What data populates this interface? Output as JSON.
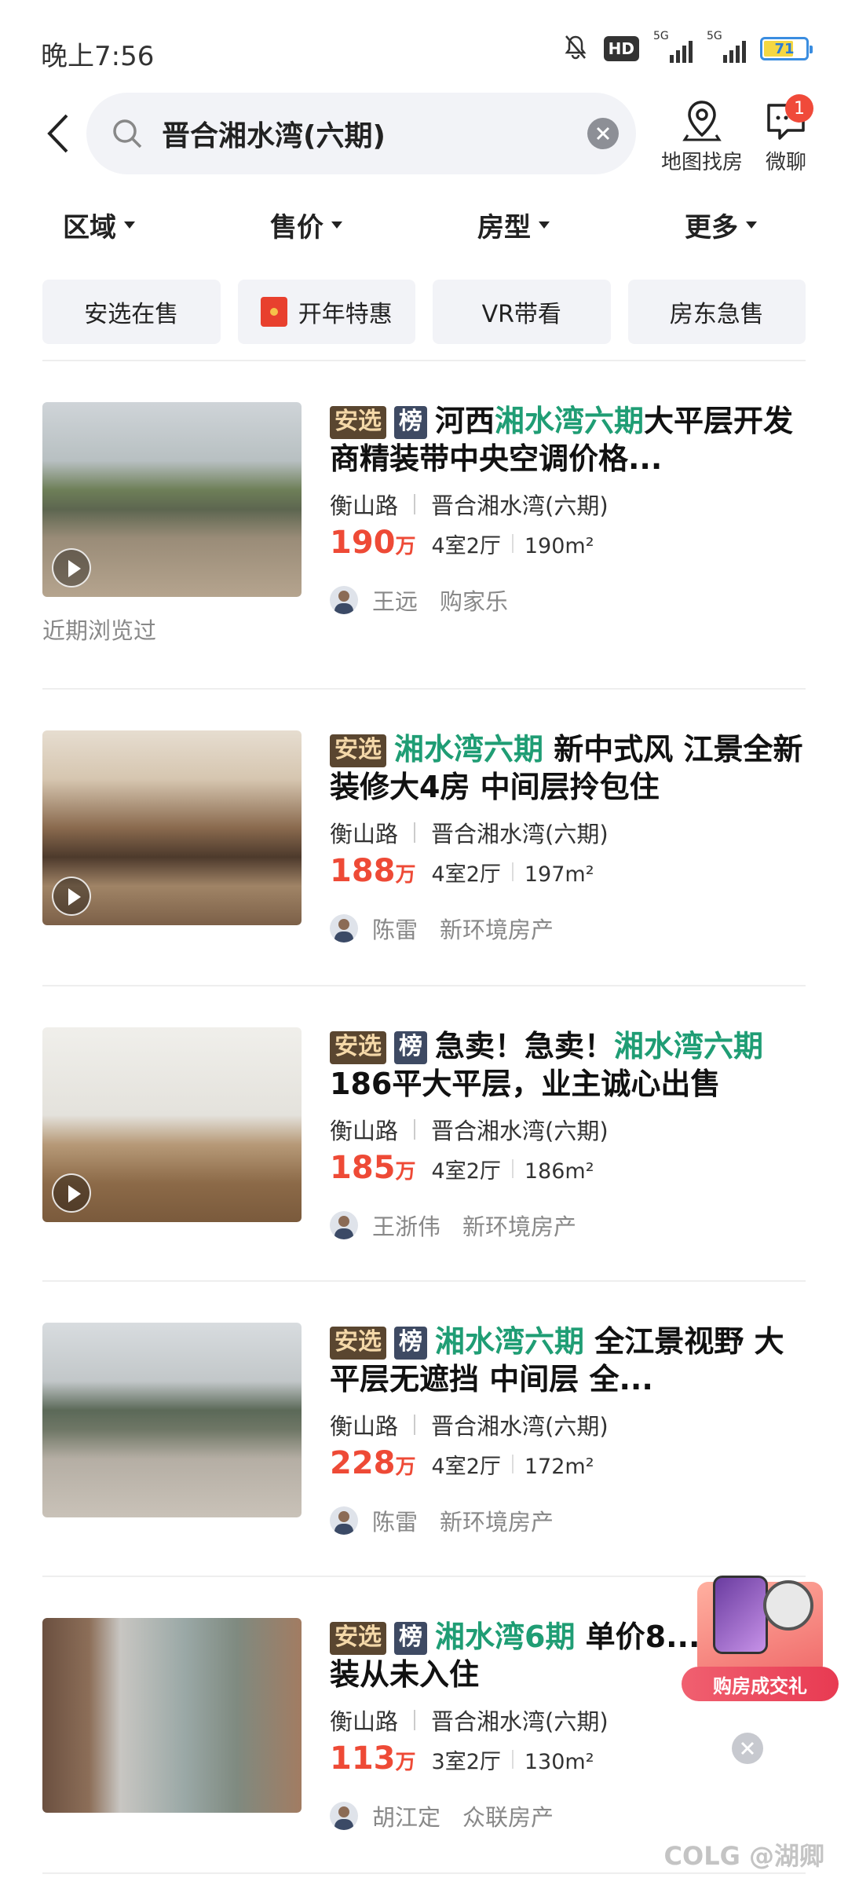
{
  "status_bar": {
    "time": "晚上7:56",
    "hd": "HD",
    "network_1": "5G",
    "network_2": "5G",
    "battery": "71",
    "battery_level": 0.71
  },
  "search": {
    "query": "晋合湘水湾(六期)"
  },
  "header_actions": {
    "map_label": "地图找房",
    "chat_label": "微聊",
    "chat_badge": "1"
  },
  "filters": [
    "区域",
    "售价",
    "房型",
    "更多"
  ],
  "chips": [
    "安选在售",
    "开年特惠",
    "VR带看",
    "房东急售"
  ],
  "listings": [
    {
      "tag_anxuan": "安选",
      "tag_bang": "榜",
      "title_parts": [
        "河西",
        "湘水湾六期",
        "大平层开发商精装带中央空调价格..."
      ],
      "location": "衡山路",
      "community": "晋合湘水湾(六期)",
      "price": "190",
      "unit": "万",
      "layout": "4室2厅",
      "area": "190m²",
      "agent": "王远",
      "company": "购家乐",
      "note": "近期浏览过"
    },
    {
      "tag_anxuan": "安选",
      "title_parts": [
        "",
        "湘水湾六期",
        " 新中式风 江景全新装修大4房 中间层拎包住"
      ],
      "location": "衡山路",
      "community": "晋合湘水湾(六期)",
      "price": "188",
      "unit": "万",
      "layout": "4室2厅",
      "area": "197m²",
      "agent": "陈雷",
      "company": "新环境房产"
    },
    {
      "tag_anxuan": "安选",
      "tag_bang": "榜",
      "title_parts": [
        "急卖！急卖！",
        "湘水湾六期",
        "186平大平层，业主诚心出售"
      ],
      "location": "衡山路",
      "community": "晋合湘水湾(六期)",
      "price": "185",
      "unit": "万",
      "layout": "4室2厅",
      "area": "186m²",
      "agent": "王浙伟",
      "company": "新环境房产"
    },
    {
      "tag_anxuan": "安选",
      "tag_bang": "榜",
      "title_parts": [
        "",
        "湘水湾六期",
        " 全江景视野 大平层无遮挡 中间层 全..."
      ],
      "location": "衡山路",
      "community": "晋合湘水湾(六期)",
      "price": "228",
      "unit": "万",
      "layout": "4室2厅",
      "area": "172m²",
      "agent": "陈雷",
      "company": "新环境房产"
    },
    {
      "tag_anxuan": "安选",
      "tag_bang": "榜",
      "title_parts": [
        "",
        "湘水湾6期",
        " 单价8...全新精装从未入住"
      ],
      "location": "衡山路",
      "community": "晋合湘水湾(六期)",
      "price": "113",
      "unit": "万",
      "layout": "3室2厅",
      "area": "130m²",
      "agent": "胡江定",
      "company": "众联房产"
    }
  ],
  "promo": {
    "label": "购房成交礼"
  },
  "watermark": "COLG @湖卿",
  "colors": {
    "price": "#ee4a36",
    "highlight": "#1f9d74",
    "tag_anxuan_bg": "#5a4630",
    "tag_bang_bg": "#3e4a63"
  }
}
